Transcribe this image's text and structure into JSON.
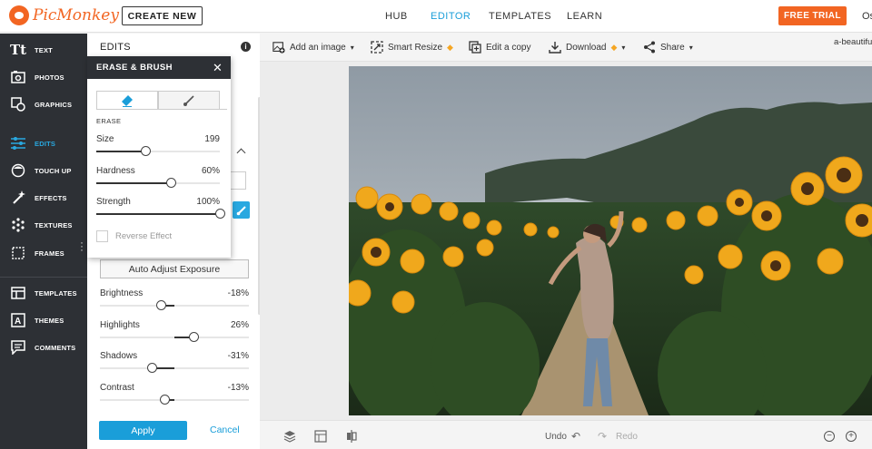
{
  "brand": {
    "name": "PicMonkey",
    "accent": "#f26522",
    "highlight": "#1a9ed9"
  },
  "topnav": {
    "create_new": "CREATE NEW",
    "links": [
      "HUB",
      "EDITOR",
      "TEMPLATES",
      "LEARN"
    ],
    "active": "EDITOR",
    "free_trial": "FREE TRIAL",
    "user_initial": "Os"
  },
  "sidebar": {
    "items": [
      {
        "label": "TEXT",
        "icon": "text-icon"
      },
      {
        "label": "PHOTOS",
        "icon": "photos-icon"
      },
      {
        "label": "GRAPHICS",
        "icon": "graphics-icon"
      },
      {
        "label": "EDITS",
        "icon": "edits-sliders-icon",
        "active": true
      },
      {
        "label": "TOUCH UP",
        "icon": "touch-up-face-icon"
      },
      {
        "label": "EFFECTS",
        "icon": "effects-wand-icon"
      },
      {
        "label": "TEXTURES",
        "icon": "textures-icon"
      },
      {
        "label": "FRAMES",
        "icon": "frames-icon"
      },
      {
        "label": "TEMPLATES",
        "icon": "templates-icon"
      },
      {
        "label": "THEMES",
        "icon": "themes-icon"
      },
      {
        "label": "COMMENTS",
        "icon": "comments-icon"
      }
    ]
  },
  "edits_panel": {
    "title": "EDITS",
    "auto_adjust": "Auto Adjust Exposure",
    "adjustments": [
      {
        "label": "Brightness",
        "value": "-18%",
        "level": -0.18
      },
      {
        "label": "Highlights",
        "value": "26%",
        "level": 0.26
      },
      {
        "label": "Shadows",
        "value": "-31%",
        "level": -0.31
      },
      {
        "label": "Contrast",
        "value": "-13%",
        "level": -0.13
      }
    ],
    "apply": "Apply",
    "cancel": "Cancel"
  },
  "erase_brush": {
    "title": "ERASE & BRUSH",
    "tabs": [
      "eraser-icon",
      "brush-icon"
    ],
    "section": "ERASE",
    "sliders": [
      {
        "label": "Size",
        "value": "199",
        "level": 0.4
      },
      {
        "label": "Hardness",
        "value": "60%",
        "level": 0.6
      },
      {
        "label": "Strength",
        "value": "100%",
        "level": 1.0
      }
    ],
    "reverse_effect": "Reverse Effect"
  },
  "toolbar": {
    "add_image": "Add an image",
    "smart_resize": "Smart Resize",
    "edit_copy": "Edit a copy",
    "download": "Download",
    "share": "Share",
    "file_title": "a-beautiful"
  },
  "bottombar": {
    "undo": "Undo",
    "redo": "Redo"
  }
}
